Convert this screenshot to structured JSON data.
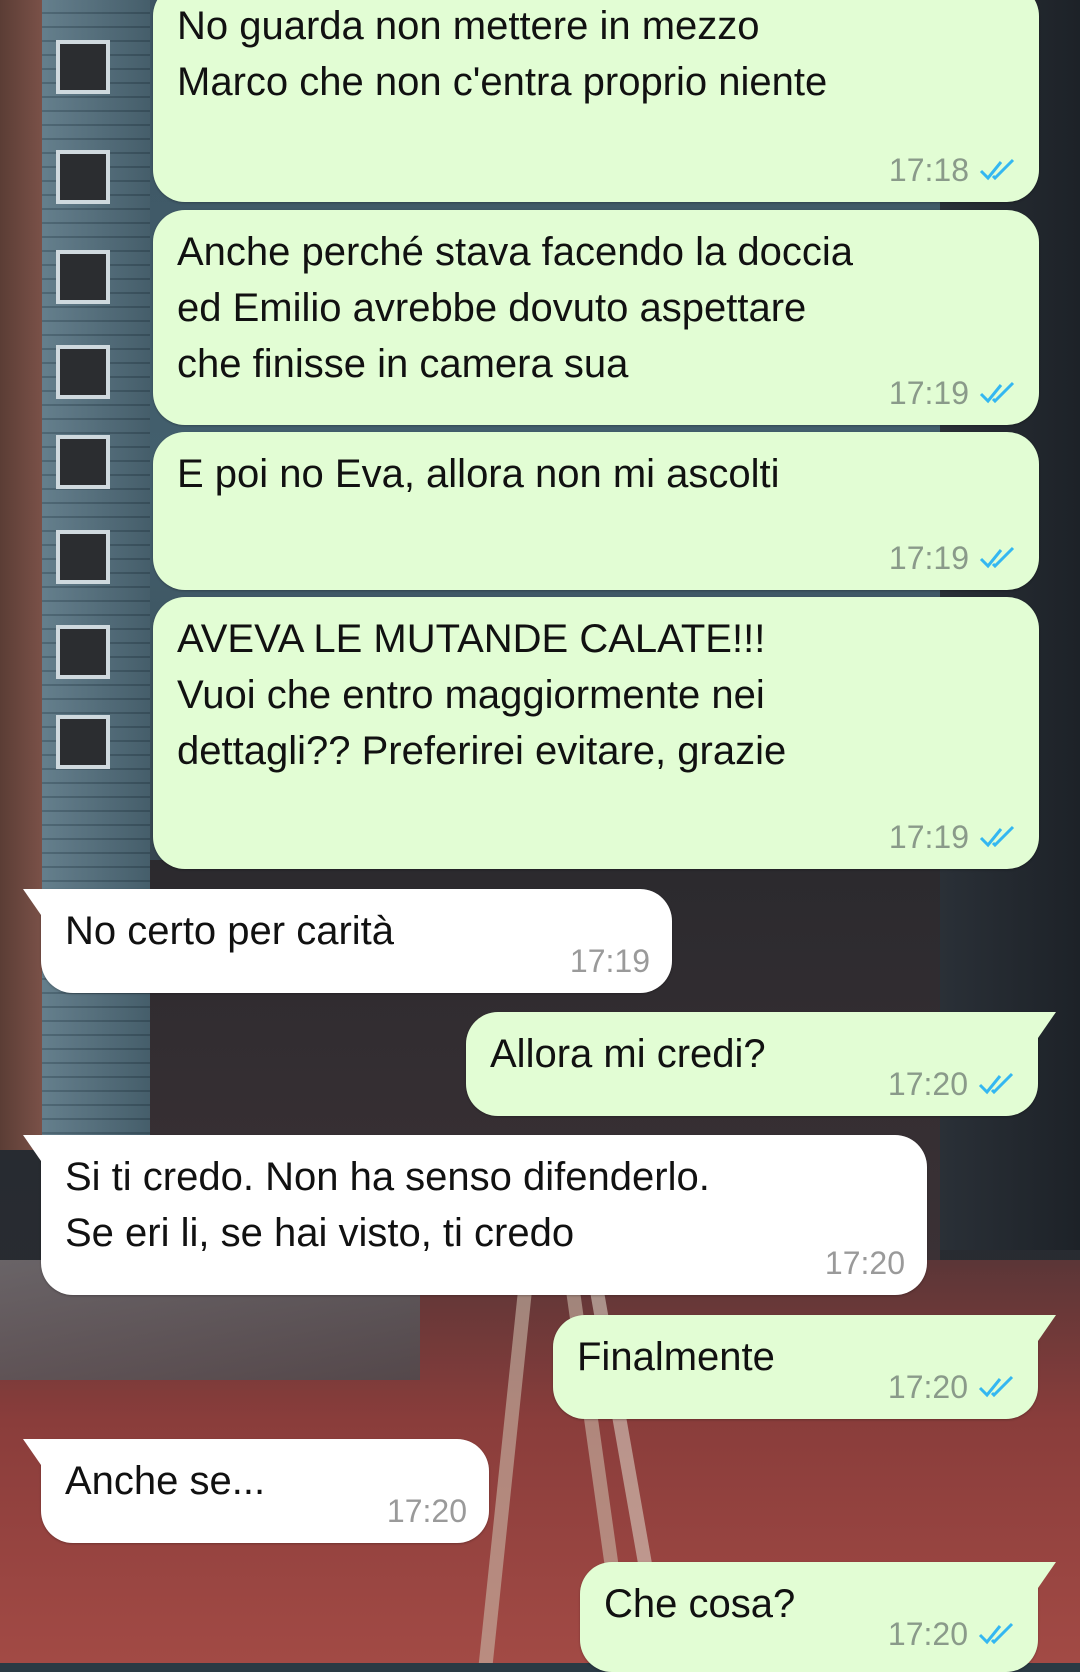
{
  "colors": {
    "outgoing_bubble": "#e2fdd4",
    "incoming_bubble": "#ffffff",
    "read_receipt": "#34b7f1",
    "timestamp": "#8a9a8a"
  },
  "messages": [
    {
      "direction": "outgoing",
      "text": "No guarda non mettere in mezzo\nMarco che non c'entra proprio niente",
      "time": "17:18",
      "status_icon": "double-check-read-icon"
    },
    {
      "direction": "outgoing",
      "text": "Anche perché stava facendo la doccia\ned Emilio avrebbe dovuto aspettare\nche finisse in camera sua",
      "time": "17:19",
      "status_icon": "double-check-read-icon"
    },
    {
      "direction": "outgoing",
      "text": "E poi no Eva, allora non mi ascolti",
      "time": "17:19",
      "status_icon": "double-check-read-icon"
    },
    {
      "direction": "outgoing",
      "text": "AVEVA LE MUTANDE CALATE!!!\nVuoi che entro maggiormente nei\ndettagli?? Preferirei evitare, grazie",
      "time": "17:19",
      "status_icon": "double-check-read-icon"
    },
    {
      "direction": "incoming",
      "text": "No certo per carità",
      "time": "17:19"
    },
    {
      "direction": "outgoing",
      "text": "Allora mi credi?",
      "time": "17:20",
      "status_icon": "double-check-read-icon"
    },
    {
      "direction": "incoming",
      "text": "Si ti credo. Non ha senso difenderlo.\nSe eri li, se hai visto, ti credo",
      "time": "17:20"
    },
    {
      "direction": "outgoing",
      "text": "Finalmente",
      "time": "17:20",
      "status_icon": "double-check-read-icon"
    },
    {
      "direction": "incoming",
      "text": "Anche se...",
      "time": "17:20"
    },
    {
      "direction": "outgoing",
      "text": "Che cosa?",
      "time": "17:20",
      "status_icon": "double-check-read-icon"
    }
  ]
}
